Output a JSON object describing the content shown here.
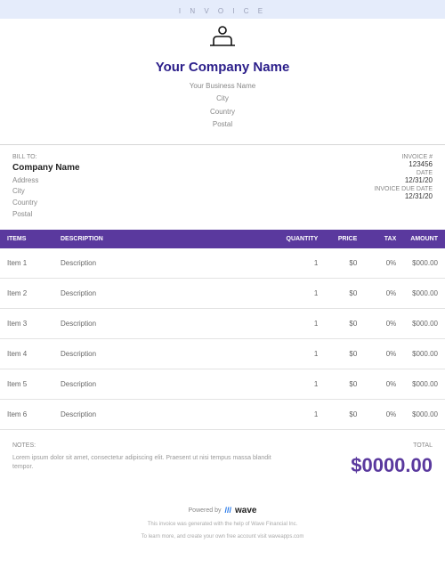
{
  "header": {
    "tag": "I N V O I C E"
  },
  "company": {
    "title": "Your Company Name",
    "business": "Your Business Name",
    "city": "City",
    "country": "Country",
    "postal": "Postal"
  },
  "bill_to": {
    "label": "BILL TO:",
    "name": "Company Name",
    "address": "Address",
    "city": "City",
    "country": "Country",
    "postal": "Postal"
  },
  "invoice_meta": {
    "number_label": "INVOICE #",
    "number": "123456",
    "date_label": "DATE",
    "date": "12/31/20",
    "due_label": "INVOICE DUE DATE",
    "due": "12/31/20"
  },
  "columns": {
    "items": "ITEMS",
    "description": "DESCRIPTION",
    "quantity": "QUANTITY",
    "price": "PRICE",
    "tax": "TAX",
    "amount": "AMOUNT"
  },
  "rows": [
    {
      "item": "Item 1",
      "desc": "Description",
      "qty": "1",
      "price": "$0",
      "tax": "0%",
      "amount": "$000.00"
    },
    {
      "item": "Item 2",
      "desc": "Description",
      "qty": "1",
      "price": "$0",
      "tax": "0%",
      "amount": "$000.00"
    },
    {
      "item": "Item 3",
      "desc": "Description",
      "qty": "1",
      "price": "$0",
      "tax": "0%",
      "amount": "$000.00"
    },
    {
      "item": "Item 4",
      "desc": "Description",
      "qty": "1",
      "price": "$0",
      "tax": "0%",
      "amount": "$000.00"
    },
    {
      "item": "Item 5",
      "desc": "Description",
      "qty": "1",
      "price": "$0",
      "tax": "0%",
      "amount": "$000.00"
    },
    {
      "item": "Item 6",
      "desc": "Description",
      "qty": "1",
      "price": "$0",
      "tax": "0%",
      "amount": "$000.00"
    }
  ],
  "notes": {
    "label": "NOTES:",
    "body": "Lorem ipsum dolor sit amet, consectetur adipiscing elit. Praesent ut nisi tempus massa blandit tempor."
  },
  "total": {
    "label": "TOTAL",
    "amount": "$0000.00"
  },
  "footer": {
    "powered": "Powered by",
    "brand_mark": "///",
    "brand_word": "wave",
    "line1": "This invoice was generated with the help of Wave Financial Inc.",
    "line2": "To learn more, and create your own free account visit waveapps.com"
  }
}
